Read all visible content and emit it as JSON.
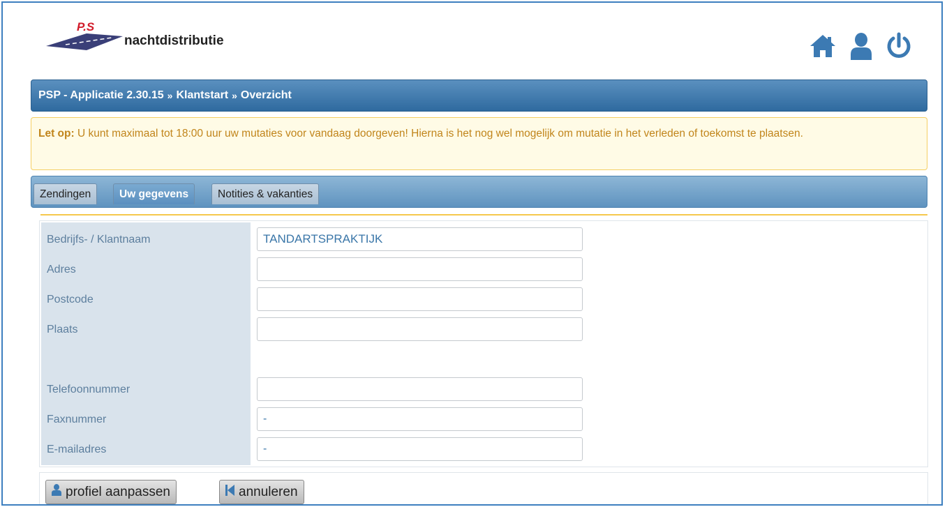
{
  "header": {
    "logo_mark_text": "P.S",
    "logo_text": "nachtdistributie",
    "icons": [
      "home-icon",
      "user-icon",
      "power-icon"
    ],
    "icon_color": "#3c7ab3"
  },
  "breadcrumb": {
    "items": [
      "PSP - Applicatie 2.30.15",
      "Klantstart",
      "Overzicht"
    ],
    "separator": "»"
  },
  "warning": {
    "prefix": "Let op:",
    "message": "U kunt maximaal tot 18:00 uur uw mutaties voor vandaag doorgeven! Hierna is het nog wel mogelijk om mutatie in het verleden of toekomst te plaatsen."
  },
  "tabs": [
    {
      "label": "Zendingen",
      "active": false
    },
    {
      "label": "Uw gegevens",
      "active": true
    },
    {
      "label": "Notities & vakanties",
      "active": false
    }
  ],
  "form": {
    "fields": [
      {
        "label": "Bedrijfs- / Klantnaam",
        "value": "TANDARTSPRAKTIJK"
      },
      {
        "label": "Adres",
        "value": ""
      },
      {
        "label": "Postcode",
        "value": ""
      },
      {
        "label": "Plaats",
        "value": ""
      },
      {
        "label": "Telefoonnummer",
        "value": ""
      },
      {
        "label": "Faxnummer",
        "value": "-"
      },
      {
        "label": "E-mailadres",
        "value": "-"
      }
    ]
  },
  "buttons": {
    "edit_profile": "profiel aanpassen",
    "cancel": "annuleren"
  },
  "colors": {
    "primary": "#2f6a9f",
    "warning_text": "#c1851b",
    "warning_bg": "#fffbe6",
    "label_text": "#5d7f9e"
  }
}
